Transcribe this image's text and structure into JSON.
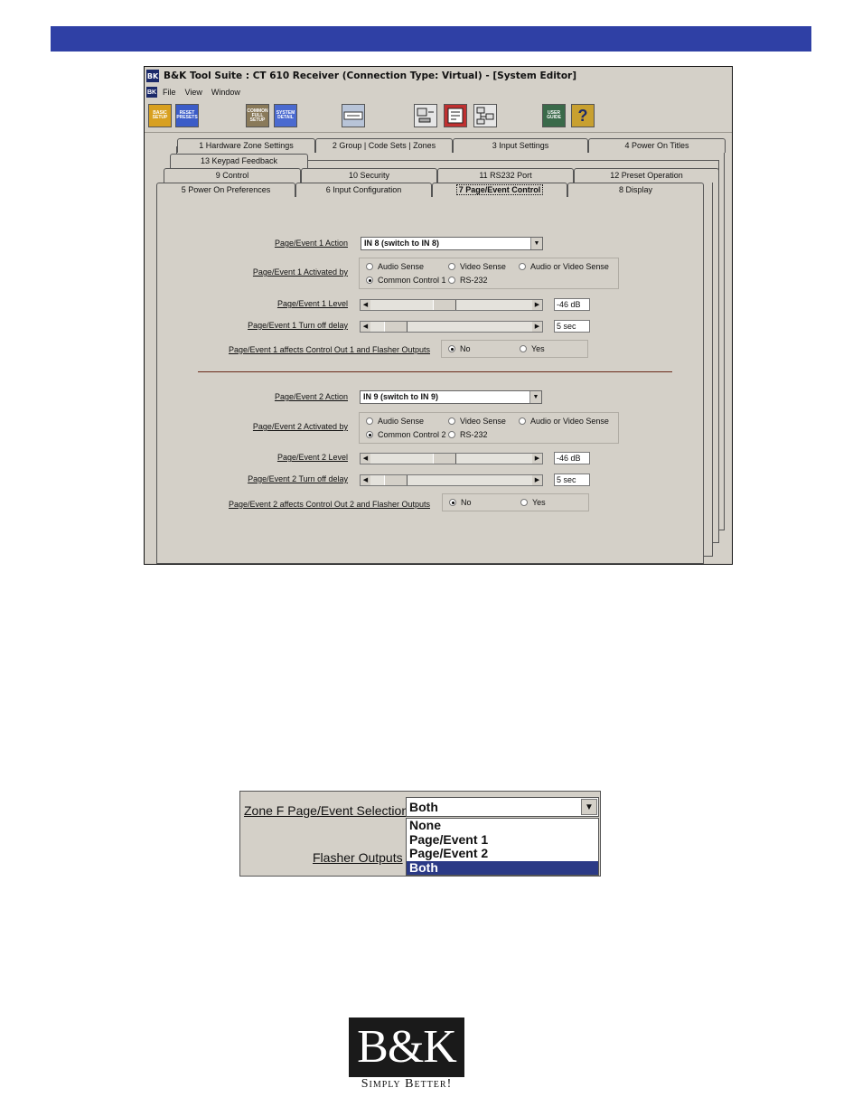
{
  "window": {
    "title": "B&K Tool Suite : CT 610 Receiver (Connection Type: Virtual) - [System Editor]",
    "app_icon": "BK",
    "menu": [
      "File",
      "View",
      "Window"
    ]
  },
  "toolbar": {
    "buttons": [
      {
        "label": "BASIC SETUP",
        "icon": "basic-setup-icon",
        "color": "#d8a020"
      },
      {
        "label": "RESET PRESETS",
        "icon": "reset-presets-icon",
        "color": "#3b5cc8"
      },
      {
        "label": "COMMON FULL SETUP",
        "icon": "common-full-setup-icon",
        "color": "#8a7a5a"
      },
      {
        "label": "SYSTEM DETAIL",
        "icon": "system-detail-icon",
        "color": "#4a6ad0"
      },
      {
        "label": "",
        "icon": "keyboard-icon",
        "color": "#b8c4d8"
      },
      {
        "label": "",
        "icon": "computer-connect-icon",
        "color": "#e6e6e6"
      },
      {
        "label": "",
        "icon": "panel-view-icon",
        "color": "#c03030"
      },
      {
        "label": "",
        "icon": "network-icon",
        "color": "#e6e6e6"
      },
      {
        "label": "USER GUIDE",
        "icon": "user-guide-icon",
        "color": "#3a6a4a"
      },
      {
        "label": "?",
        "icon": "help-icon",
        "color": "#c8a030"
      }
    ]
  },
  "tabs": {
    "row1": [
      "1  Hardware Zone Settings",
      "2  Group | Code Sets | Zones",
      "3  Input Settings",
      "4  Power On Titles"
    ],
    "row2": [
      "13 Keypad Feedback"
    ],
    "row3": [
      "9  Control",
      "10  Security",
      "11  RS232 Port",
      "12  Preset Operation"
    ],
    "row4": [
      "5  Power On Preferences",
      "6  Input Configuration",
      "7  Page/Event Control",
      "8  Display"
    ],
    "active": "7  Page/Event Control"
  },
  "events": [
    {
      "action_label": "Page/Event 1 Action",
      "action_value": "IN 8 (switch to IN 8)",
      "activated_label": "Page/Event 1 Activated by",
      "activated_options": [
        "Audio Sense",
        "Video Sense",
        "Audio or Video Sense",
        "Common Control 1",
        "RS-232"
      ],
      "activated_selected": "Common Control 1",
      "level_label": "Page/Event 1 Level",
      "level_value": "-46 dB",
      "level_fraction": 0.45,
      "delay_label": "Page/Event 1 Turn off delay",
      "delay_value": "5 sec",
      "delay_fraction": 0.1,
      "affects_label": "Page/Event 1 affects Control Out 1 and Flasher Outputs",
      "affects_options": [
        "No",
        "Yes"
      ],
      "affects_selected": "No"
    },
    {
      "action_label": "Page/Event 2 Action",
      "action_value": "IN 9 (switch to IN 9)",
      "activated_label": "Page/Event 2 Activated by",
      "activated_options": [
        "Audio Sense",
        "Video Sense",
        "Audio or Video Sense",
        "Common Control 2",
        "RS-232"
      ],
      "activated_selected": "Common Control 2",
      "level_label": "Page/Event 2 Level",
      "level_value": "-46 dB",
      "level_fraction": 0.45,
      "delay_label": "Page/Event 2 Turn off delay",
      "delay_value": "5 sec",
      "delay_fraction": 0.1,
      "affects_label": "Page/Event 2 affects Control Out 2 and Flasher Outputs",
      "affects_options": [
        "No",
        "Yes"
      ],
      "affects_selected": "No"
    }
  ],
  "zoom": {
    "selection_label": "Zone F Page/Event Selection",
    "selected_value": "Both",
    "options": [
      "None",
      "Page/Event 1",
      "Page/Event 2",
      "Both"
    ],
    "highlighted": "Both",
    "flasher_label": "Flasher Outputs"
  },
  "logo": {
    "mark": "B&K",
    "tagline": "Simply Better!"
  },
  "colors": {
    "header_bar": "#2f40a5",
    "dialog_bg": "#d4d0c8",
    "selection": "#2b3a86"
  }
}
